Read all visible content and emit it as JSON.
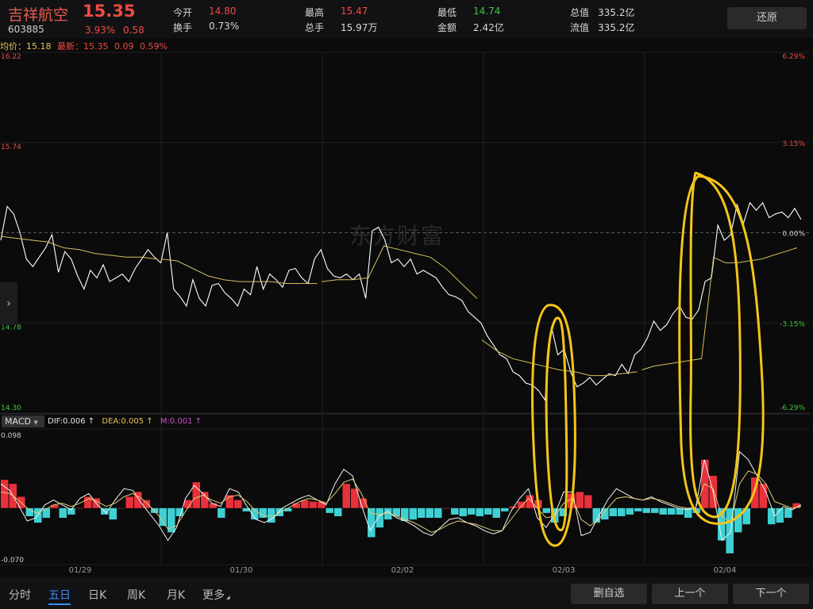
{
  "header": {
    "name": "吉祥航空",
    "code": "603885",
    "price": "15.35",
    "change_pct": "3.93%",
    "change": "0.58",
    "stats": [
      {
        "label": "今开",
        "value": "14.80",
        "color": "#ef4b43"
      },
      {
        "label": "换手",
        "value": "0.73%",
        "color": "#d8d8d8"
      },
      {
        "label": "最高",
        "value": "15.47",
        "color": "#ef4b43"
      },
      {
        "label": "总手",
        "value": "15.97万",
        "color": "#d8d8d8"
      },
      {
        "label": "最低",
        "value": "14.74",
        "color": "#3ec441"
      },
      {
        "label": "金额",
        "value": "2.42亿",
        "color": "#d8d8d8"
      },
      {
        "label": "总值",
        "value": "335.2亿",
        "color": "#d8d8d8"
      },
      {
        "label": "流值",
        "value": "335.2亿",
        "color": "#d8d8d8"
      }
    ],
    "restore_label": "还原"
  },
  "info_line": {
    "avg_label": "均价：",
    "avg_value": "15.18",
    "latest_label": "最新：",
    "latest_value": "15.35",
    "latest_change": "0.09",
    "latest_pct": "0.59%"
  },
  "watermark": "东方财富",
  "side_arrow": "›",
  "macd": {
    "indicator_label": "MACD",
    "dropdown_glyph": "▼",
    "dif": "DIF:0.006 ↑",
    "dea": "DEA:0.005 ↑",
    "m": "M:0.001 ↑"
  },
  "chart_data": [
    {
      "type": "line",
      "title": "",
      "x_labels": [
        "01/29",
        "01/30",
        "02/02",
        "02/03",
        "02/04"
      ],
      "y_ticks_left": [
        "16.22",
        "15.74",
        "14.78",
        "14.30"
      ],
      "y_ticks_right": [
        "6.29%",
        "3.15%",
        "0.00%",
        "-3.15%",
        "-6.29%"
      ],
      "ylim": [
        14.3,
        16.22
      ],
      "reference_price": 15.26,
      "series": [
        {
          "color": "#ffffff",
          "values": [
            15.22,
            15.4,
            15.36,
            15.26,
            15.12,
            15.08,
            15.13,
            15.18,
            15.25,
            15.05,
            15.16,
            15.12,
            15.03,
            14.96,
            15.06,
            15.02,
            15.09,
            15.0,
            15.02,
            15.04,
            15.0,
            15.07,
            15.12,
            15.17,
            15.13,
            15.1,
            15.26,
            14.96,
            14.92,
            14.87,
            15.01,
            14.91,
            14.87,
            14.98,
            14.99,
            14.94,
            14.91,
            14.87,
            14.96,
            14.93,
            15.08,
            14.96,
            15.04,
            15.01,
            14.97,
            15.06,
            15.07,
            15.02,
            14.99,
            15.12,
            15.17,
            15.07,
            15.03,
            15.02,
            15.04,
            15.01,
            15.04,
            14.91,
            15.27,
            15.29,
            15.22,
            15.1,
            15.12,
            15.08,
            15.12,
            15.04,
            15.06,
            15.04,
            15.02,
            14.97,
            14.93,
            14.92,
            14.9,
            14.84,
            14.81,
            14.78,
            14.71,
            14.66,
            14.61,
            14.59,
            14.52,
            14.5,
            14.46,
            14.45,
            14.42,
            14.37,
            14.76,
            14.61,
            14.64,
            14.52,
            14.44,
            14.46,
            14.49,
            14.45,
            14.48,
            14.51,
            14.5,
            14.56,
            14.51,
            14.61,
            14.64,
            14.7,
            14.79,
            14.74,
            14.77,
            14.83,
            14.87,
            14.81,
            14.8,
            14.85,
            15.0,
            15.02,
            15.3,
            15.22,
            15.25,
            15.41,
            15.31,
            15.42,
            15.38,
            15.42,
            15.34,
            15.36,
            15.37,
            15.34,
            15.39,
            15.33
          ]
        },
        {
          "color": "#d4bf5a",
          "values": [
            15.24,
            15.23,
            15.22,
            15.21,
            15.18,
            15.17,
            15.15,
            15.14,
            15.13,
            15.13,
            15.12,
            15.12,
            15.11,
            15.07,
            15.03,
            15.01,
            15.0,
            15.0,
            15.0,
            14.99,
            14.99,
            14.99,
            15.0,
            15.01,
            15.01,
            15.02,
            15.19,
            15.17,
            15.15,
            15.13,
            15.07,
            14.99,
            14.91,
            14.69,
            14.63,
            14.59,
            14.57,
            14.55,
            14.53,
            14.52,
            14.5,
            14.5,
            14.51,
            14.52,
            14.53,
            14.55,
            14.56,
            14.57,
            14.58,
            14.59,
            15.13,
            15.1,
            15.1,
            15.11,
            15.12,
            15.14,
            15.16,
            15.18
          ]
        }
      ]
    },
    {
      "type": "bar",
      "title": "MACD",
      "y_ticks_left": [
        "0.098",
        "-0.070"
      ],
      "ylim": [
        -0.07,
        0.098
      ],
      "histogram": [
        0.035,
        0.03,
        0.014,
        -0.01,
        -0.018,
        -0.012,
        0.004,
        -0.012,
        -0.008,
        0.0,
        0.014,
        0.012,
        -0.008,
        -0.014,
        0.0,
        0.014,
        0.02,
        0.01,
        -0.006,
        -0.022,
        -0.03,
        -0.01,
        0.01,
        0.032,
        0.02,
        0.006,
        -0.012,
        0.016,
        0.01,
        -0.004,
        -0.014,
        -0.012,
        -0.018,
        -0.01,
        -0.004,
        0.006,
        0.01,
        0.008,
        0.008,
        -0.006,
        -0.01,
        0.03,
        0.024,
        0.012,
        -0.036,
        -0.024,
        -0.014,
        -0.01,
        -0.016,
        -0.014,
        -0.012,
        -0.012,
        -0.012,
        0.0,
        -0.008,
        -0.01,
        -0.008,
        -0.01,
        -0.008,
        -0.012,
        -0.004,
        0.002,
        0.008,
        0.016,
        0.01,
        -0.006,
        -0.018,
        -0.01,
        0.018,
        0.02,
        0.016,
        -0.018,
        -0.014,
        -0.01,
        -0.01,
        -0.008,
        -0.004,
        -0.006,
        -0.006,
        -0.008,
        -0.008,
        -0.008,
        -0.012,
        -0.006,
        0.06,
        0.04,
        -0.04,
        -0.056,
        -0.03,
        -0.02,
        0.038,
        0.03,
        -0.02,
        -0.018,
        -0.012,
        0.006
      ],
      "dif": [
        0.03,
        0.022,
        0.004,
        -0.016,
        -0.012,
        0.004,
        0.01,
        0.004,
        -0.002,
        0.012,
        0.018,
        0.004,
        -0.006,
        0.01,
        0.024,
        0.022,
        0.006,
        -0.008,
        -0.022,
        -0.04,
        -0.024,
        0.012,
        0.028,
        0.018,
        0.006,
        0.002,
        0.024,
        0.02,
        0.002,
        -0.014,
        -0.018,
        -0.012,
        0.0,
        0.006,
        0.012,
        0.016,
        0.01,
        0.004,
        0.03,
        0.048,
        0.04,
        0.004,
        -0.028,
        -0.01,
        -0.004,
        -0.012,
        -0.016,
        -0.022,
        -0.03,
        -0.034,
        -0.024,
        -0.014,
        -0.012,
        -0.018,
        -0.022,
        -0.028,
        -0.032,
        -0.028,
        -0.004,
        0.012,
        0.024,
        -0.012,
        -0.024,
        -0.008,
        0.02,
        0.02,
        -0.034,
        -0.03,
        -0.01,
        0.01,
        0.024,
        0.018,
        0.012,
        0.01,
        0.014,
        0.008,
        0.004,
        0.0,
        -0.002,
        0.0,
        0.06,
        0.02,
        -0.04,
        -0.03,
        0.07,
        0.06,
        0.04,
        0.02,
        -0.01,
        0.002,
        -0.002,
        0.004
      ],
      "dea": [
        0.02,
        0.018,
        0.01,
        0.0,
        -0.006,
        -0.002,
        0.004,
        0.006,
        0.002,
        0.006,
        0.012,
        0.008,
        0.002,
        0.006,
        0.014,
        0.018,
        0.012,
        0.002,
        -0.01,
        -0.026,
        -0.022,
        -0.004,
        0.012,
        0.016,
        0.01,
        0.006,
        0.014,
        0.016,
        0.008,
        -0.004,
        -0.01,
        -0.01,
        -0.004,
        0.002,
        0.008,
        0.012,
        0.01,
        0.006,
        0.018,
        0.032,
        0.036,
        0.018,
        -0.006,
        -0.008,
        -0.006,
        -0.01,
        -0.014,
        -0.018,
        -0.024,
        -0.03,
        -0.026,
        -0.02,
        -0.016,
        -0.018,
        -0.02,
        -0.024,
        -0.028,
        -0.028,
        -0.014,
        0.0,
        0.012,
        0.0,
        -0.012,
        -0.01,
        0.006,
        0.012,
        -0.014,
        -0.022,
        -0.014,
        0.0,
        0.012,
        0.014,
        0.012,
        0.01,
        0.012,
        0.01,
        0.006,
        0.002,
        0.0,
        0.0,
        0.03,
        0.024,
        -0.01,
        -0.018,
        0.03,
        0.046,
        0.042,
        0.03,
        0.008,
        0.004,
        0.0,
        0.002
      ]
    }
  ],
  "tabs": [
    {
      "label": "分时",
      "active": false
    },
    {
      "label": "五日",
      "active": true
    },
    {
      "label": "日K",
      "active": false
    },
    {
      "label": "周K",
      "active": false
    },
    {
      "label": "月K",
      "active": false
    },
    {
      "label": "更多",
      "active": false
    }
  ],
  "tab_more_glyph": "◢",
  "actions": {
    "remove_label": "删自选",
    "prev_label": "上一个",
    "next_label": "下一个"
  }
}
